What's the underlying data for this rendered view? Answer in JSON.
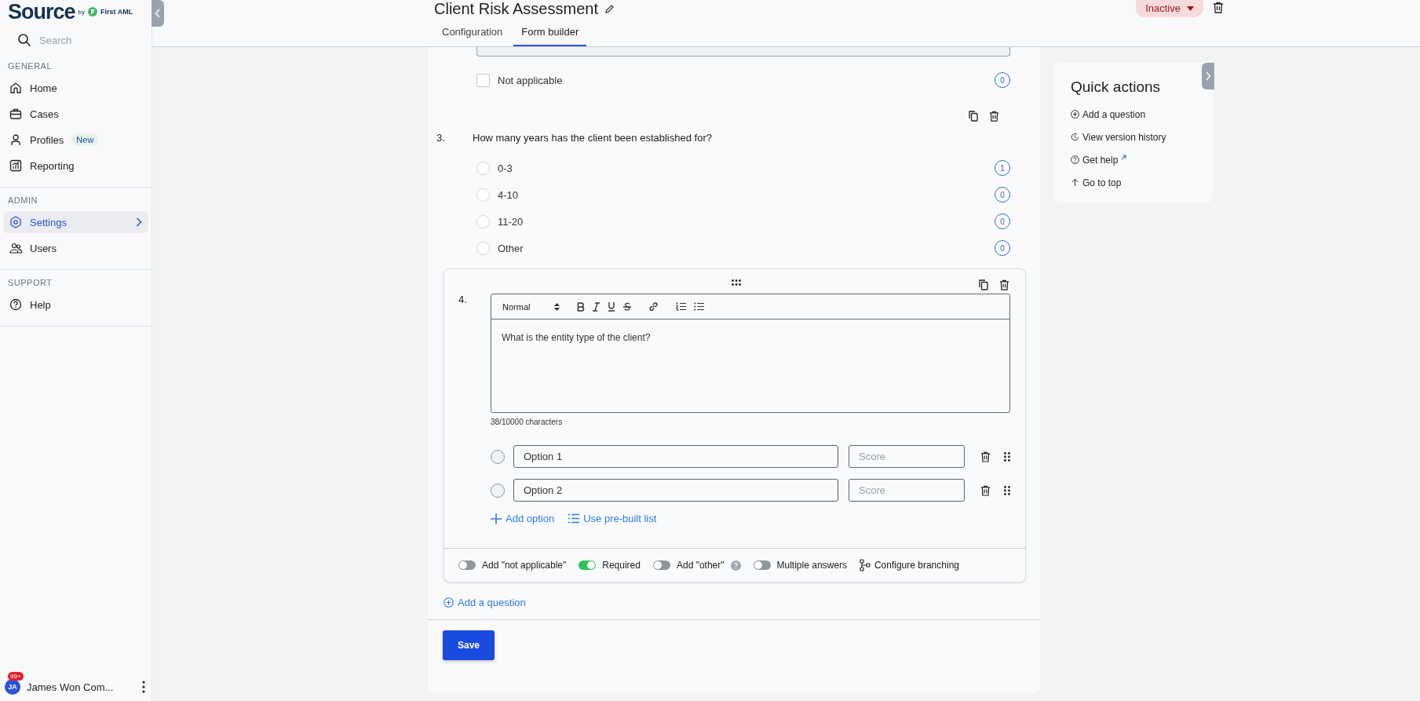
{
  "sidebar": {
    "logo": "Source",
    "logo_by": "by",
    "logo_brand": "First AML",
    "search": {
      "placeholder": "Search"
    },
    "sections": [
      {
        "heading": "GENERAL",
        "items": [
          {
            "label": "Home",
            "selected": false
          },
          {
            "label": "Cases",
            "selected": false
          },
          {
            "label": "Profiles",
            "badge": "New",
            "selected": false
          },
          {
            "label": "Reporting",
            "selected": false
          }
        ]
      },
      {
        "heading": "ADMIN",
        "items": [
          {
            "label": "Settings",
            "selected": true
          },
          {
            "label": "Users",
            "selected": false
          }
        ]
      },
      {
        "heading": "SUPPORT",
        "items": [
          {
            "label": "Help",
            "selected": false
          }
        ]
      }
    ],
    "user": {
      "initials": "JA",
      "badge": "99+",
      "name": "James Won Com..."
    }
  },
  "header": {
    "title": "Client Risk Assessment",
    "status": "Inactive",
    "tabs": [
      {
        "label": "Configuration",
        "selected": false
      },
      {
        "label": "Form builder",
        "selected": true
      }
    ]
  },
  "form": {
    "previous": {
      "option": "Not applicable",
      "checked": false,
      "score": "0"
    },
    "question": {
      "number": "3.",
      "text": "How many years has the client been established for?",
      "options": [
        {
          "label": "0-3",
          "score": "1",
          "selected": false
        },
        {
          "label": "4-10",
          "score": "0",
          "selected": false
        },
        {
          "label": "11-20",
          "score": "0",
          "selected": false
        },
        {
          "label": "Other",
          "score": "0",
          "selected": false
        }
      ]
    },
    "editor": {
      "number": "4.",
      "format": "Normal",
      "text": "What is the entity type of the client?",
      "counter": "38/10000 characters",
      "options": [
        {
          "value": "Option 1",
          "score_placeholder": "Score",
          "selected": false
        },
        {
          "value": "Option 2",
          "score_placeholder": "Score",
          "selected": false
        }
      ],
      "add_option": "Add option",
      "prebuilt": "Use pre-built list",
      "toggles": [
        {
          "label": "Add \"not applicable\"",
          "on": false,
          "help": false
        },
        {
          "label": "Required",
          "on": true,
          "help": false
        },
        {
          "label": "Add \"other\"",
          "on": false,
          "help": true
        },
        {
          "label": "Multiple answers",
          "on": false,
          "help": false
        }
      ],
      "branching": "Configure branching"
    },
    "add_question": "Add a question",
    "save": "Save"
  },
  "quick_actions": {
    "title": "Quick actions",
    "items": [
      {
        "label": "Add a question",
        "external": false
      },
      {
        "label": "View version history",
        "external": false
      },
      {
        "label": "Get help",
        "external": true
      },
      {
        "label": "Go to top",
        "external": false
      }
    ]
  }
}
